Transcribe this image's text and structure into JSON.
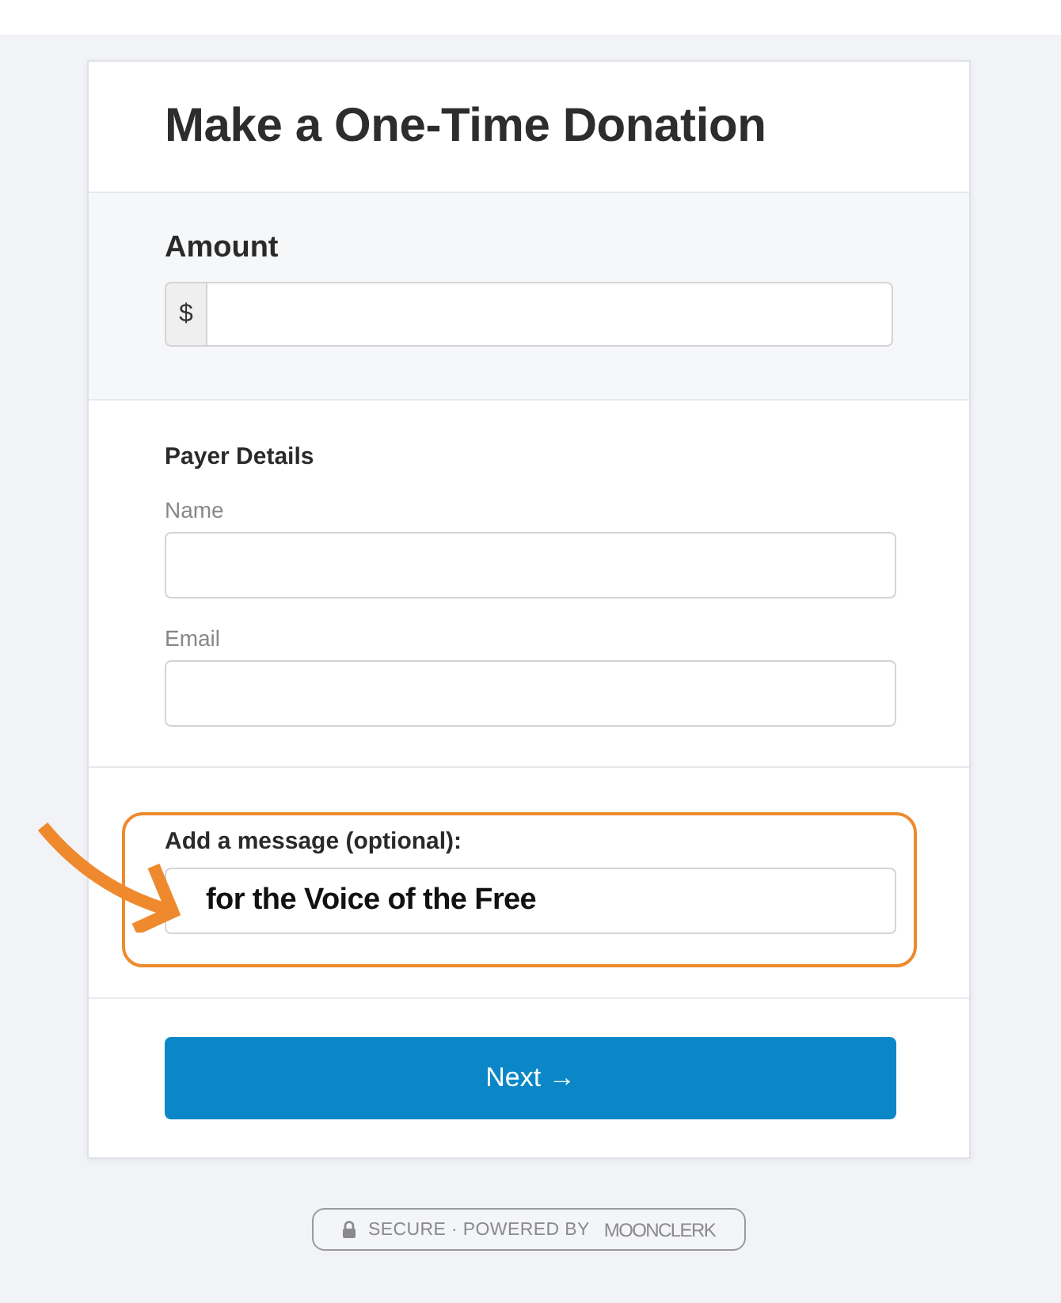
{
  "title": "Make a One-Time Donation",
  "amount": {
    "label": "Amount",
    "prefix": "$"
  },
  "payer": {
    "heading": "Payer Details",
    "fields": [
      {
        "label": "Name"
      },
      {
        "label": "Email"
      }
    ]
  },
  "message": {
    "label": "Add a message (optional):",
    "value": "for the Voice of the Free",
    "highlighted": true
  },
  "next_button": {
    "label": "Next →"
  },
  "footer": {
    "text": "SECURE · POWERED BY",
    "logo": "MOONCLERK"
  }
}
